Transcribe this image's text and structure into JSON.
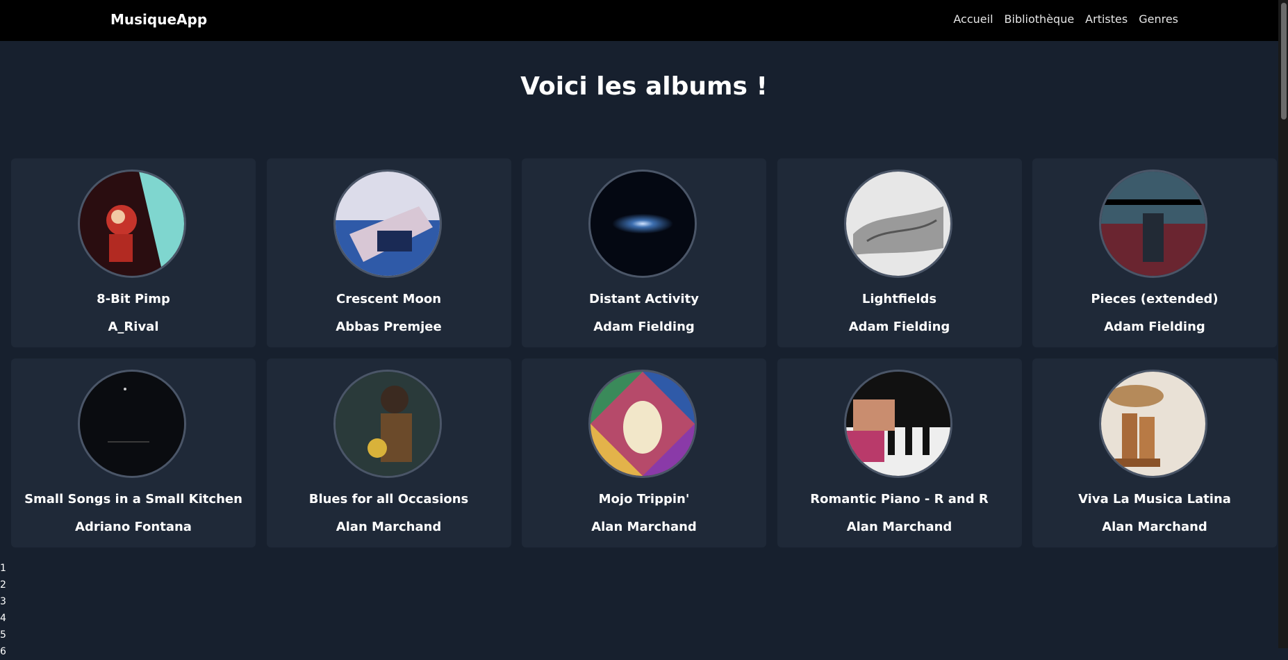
{
  "app": {
    "brand": "MusiqueApp"
  },
  "nav": {
    "links": [
      "Accueil",
      "Bibliothèque",
      "Artistes",
      "Genres"
    ]
  },
  "main": {
    "title": "Voici les albums !"
  },
  "albums": [
    {
      "title": "8-Bit Pimp",
      "artist": "A_Rival"
    },
    {
      "title": "Crescent Moon",
      "artist": "Abbas Premjee"
    },
    {
      "title": "Distant Activity",
      "artist": "Adam Fielding"
    },
    {
      "title": "Lightfields",
      "artist": "Adam Fielding"
    },
    {
      "title": "Pieces (extended)",
      "artist": "Adam Fielding"
    },
    {
      "title": "Small Songs in a Small Kitchen",
      "artist": "Adriano Fontana"
    },
    {
      "title": "Blues for all Occasions",
      "artist": "Alan Marchand"
    },
    {
      "title": "Mojo Trippin'",
      "artist": "Alan Marchand"
    },
    {
      "title": "Romantic Piano - R and R",
      "artist": "Alan Marchand"
    },
    {
      "title": "Viva La Musica Latina",
      "artist": "Alan Marchand"
    }
  ],
  "pagination": {
    "pages": [
      "1",
      "2",
      "3",
      "4",
      "5",
      "6"
    ]
  },
  "colors": {
    "background": "#17202e",
    "navbar": "#000000",
    "card": "#1f2938",
    "cover_border": "#4b5668"
  }
}
